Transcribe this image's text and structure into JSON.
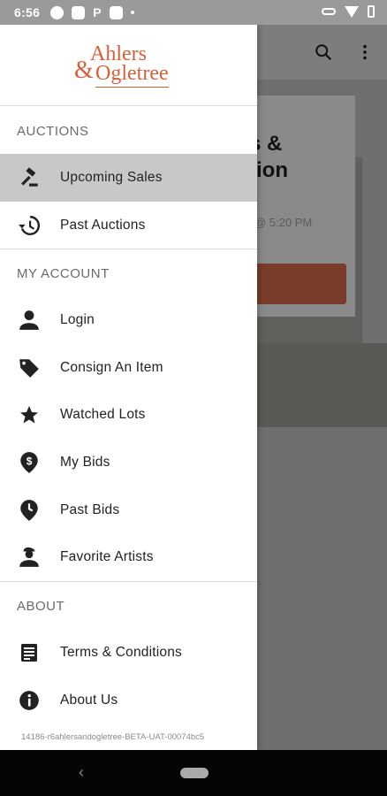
{
  "status_bar": {
    "time": "6:56",
    "p_label": "P"
  },
  "app_background": {
    "heading": "s &\ntion",
    "date_text": "@ 5:20 PM"
  },
  "drawer": {
    "brand": {
      "line1": "Ahlers",
      "amp": "&",
      "line2": "Ogletree"
    },
    "sections": [
      {
        "title": "AUCTIONS"
      },
      {
        "title": "MY ACCOUNT"
      },
      {
        "title": "ABOUT"
      }
    ],
    "items": [
      {
        "label": "Upcoming Sales",
        "icon": "gavel-icon",
        "active": true
      },
      {
        "label": "Past Auctions",
        "icon": "history-icon"
      },
      {
        "label": "Login",
        "icon": "person-icon"
      },
      {
        "label": "Consign An Item",
        "icon": "tag-icon"
      },
      {
        "label": "Watched Lots",
        "icon": "star-icon"
      },
      {
        "label": "My Bids",
        "icon": "dollar-pin-icon"
      },
      {
        "label": "Past Bids",
        "icon": "clock-pin-icon"
      },
      {
        "label": "Favorite Artists",
        "icon": "artist-icon"
      },
      {
        "label": "Terms & Conditions",
        "icon": "document-icon"
      },
      {
        "label": "About Us",
        "icon": "info-icon"
      }
    ],
    "build_id": "14186-r6ahlersandogletree-BETA-UAT-00074bc5"
  },
  "colors": {
    "brand": "#d4613a",
    "active_bg": "#c8c8c8"
  }
}
